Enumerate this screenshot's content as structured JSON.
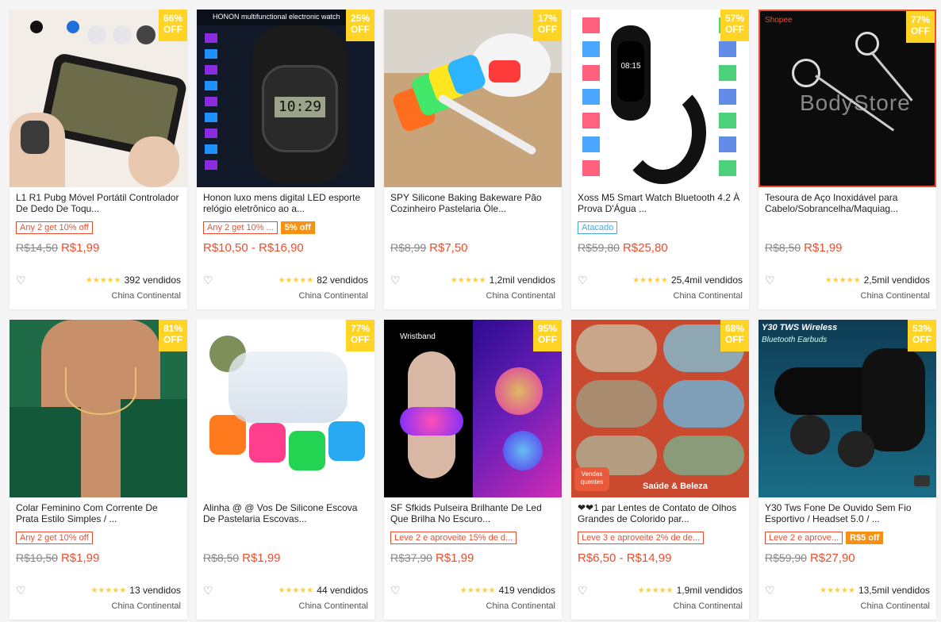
{
  "products": [
    {
      "title": "L1 R1 Pubg Móvel Portátil Controlador De Dedo De Toqu...",
      "discount": "66%",
      "off": "OFF",
      "promo": "Any 2 get 10% off",
      "tag_off": "",
      "old_price": "R$14,50",
      "price": "R$1,99",
      "sold": "392 vendidos",
      "location": "China Continental"
    },
    {
      "title": "Honon luxo mens digital LED esporte relógio eletrônico ao a...",
      "discount": "25%",
      "off": "OFF",
      "promo": "Any 2 get 10% ...",
      "tag_off": "5% off",
      "old_price": "",
      "price": "R$10,50 - R$16,90",
      "sold": "82 vendidos",
      "location": "China Continental"
    },
    {
      "title": "SPY Silicone Baking Bakeware Pão Cozinheiro Pastelaria Óle...",
      "discount": "17%",
      "off": "OFF",
      "promo": "",
      "tag_off": "",
      "old_price": "R$8,99",
      "price": "R$7,50",
      "sold": "1,2mil vendidos",
      "location": "China Continental"
    },
    {
      "title": "Xoss M5 Smart Watch Bluetooth 4.2 À Prova D'Água ...",
      "discount": "57%",
      "off": "OFF",
      "promo": "Atacado",
      "tag_off": "",
      "old_price": "R$59,80",
      "price": "R$25,80",
      "sold": "25,4mil vendidos",
      "location": "China Continental"
    },
    {
      "title": "Tesoura de Aço Inoxidável para Cabelo/Sobrancelha/Maquiag...",
      "discount": "77%",
      "off": "OFF",
      "promo": "",
      "tag_off": "",
      "old_price": "R$8,50",
      "price": "R$1,99",
      "sold": "2,5mil vendidos",
      "location": "China Continental"
    },
    {
      "title": "Colar Feminino Com Corrente De Prata Estilo Simples / ...",
      "discount": "81%",
      "off": "OFF",
      "promo": "Any 2 get 10% off",
      "tag_off": "",
      "old_price": "R$10,50",
      "price": "R$1,99",
      "sold": "13 vendidos",
      "location": "China Continental"
    },
    {
      "title": "Alinha @ @ Vos De Silicone Escova De Pastelaria Escovas...",
      "discount": "77%",
      "off": "OFF",
      "promo": "",
      "tag_off": "",
      "old_price": "R$8,50",
      "price": "R$1,99",
      "sold": "44 vendidos",
      "location": "China Continental"
    },
    {
      "title": "SF Sfkids Pulseira Brilhante De Led Que Brilha No Escuro...",
      "discount": "95%",
      "off": "OFF",
      "promo": "Leve 2 e aproveite 15% de d...",
      "tag_off": "",
      "old_price": "R$37,90",
      "price": "R$1,99",
      "sold": "419 vendidos",
      "location": "China Continental"
    },
    {
      "title": "❤❤1 par Lentes de Contato de Olhos Grandes de Colorido par...",
      "discount": "68%",
      "off": "OFF",
      "promo": "Leve 3 e aproveite 2% de de...",
      "tag_off": "",
      "old_price": "",
      "price": "R$6,50 - R$14,99",
      "sold": "1,9mil vendidos",
      "location": "China Continental"
    },
    {
      "title": "Y30 Tws Fone De Ouvido Sem Fio Esportivo / Headset 5.0 / ...",
      "discount": "53%",
      "off": "OFF",
      "promo": "Leve 2 e aprove...",
      "tag_off": "R$5 off",
      "old_price": "R$59,90",
      "price": "R$27,90",
      "sold": "13,5mil vendidos",
      "location": "China Continental"
    }
  ],
  "image_text": {
    "watch_header": "HONON multifunctional electronic watch",
    "watch_time": "10:29",
    "band_time": "08:15",
    "scissors_store": "BodyStore",
    "shopee": "Shopee",
    "bracelet_label": "Wristband",
    "lens_banner": "Saúde & Beleza",
    "lens_tag": "Vendas quentes",
    "earbuds_title": "Y30 TWS Wireless",
    "earbuds_sub": "Bluetooth Earbuds"
  },
  "colors": {
    "accent": "#ee4d2d",
    "badge": "#ffd424",
    "stars": "#ffce3d"
  }
}
